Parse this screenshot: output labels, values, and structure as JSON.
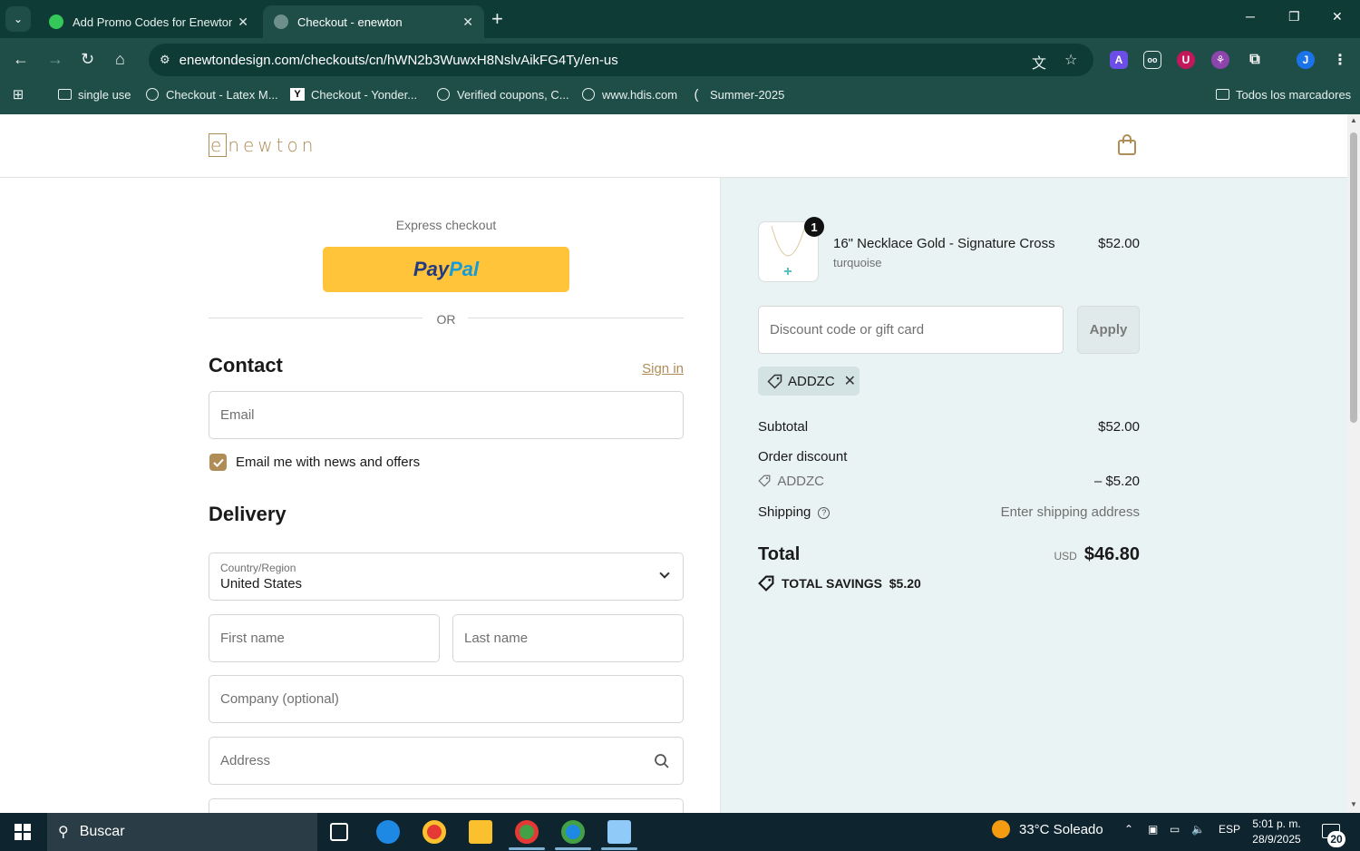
{
  "browser": {
    "tabs": [
      {
        "title": "Add Promo Codes for Enewton",
        "active": false
      },
      {
        "title": "Checkout - enewton",
        "active": true
      }
    ],
    "url": "enewtondesign.com/checkouts/cn/hWN2b3WuwxH8NslvAikFG4Ty/en-us",
    "bookmarks": [
      "single use",
      "Checkout - Latex M...",
      "Checkout - Yonder...",
      "Verified coupons, C...",
      "www.hdis.com",
      "Summer-2025"
    ],
    "all_bookmarks": "Todos los marcadores",
    "profile_initial": "J"
  },
  "store": {
    "logo_text": "enewton",
    "accent_color": "#b08d57"
  },
  "checkout": {
    "express_label": "Express checkout",
    "paypal_label_1": "Pay",
    "paypal_label_2": "Pal",
    "or_label": "OR",
    "contact_heading": "Contact",
    "sign_in": "Sign in",
    "email_placeholder": "Email",
    "news_offers_label": "Email me with news and offers",
    "news_offers_checked": true,
    "delivery_heading": "Delivery",
    "country_label": "Country/Region",
    "country_value": "United States",
    "first_name_placeholder": "First name",
    "last_name_placeholder": "Last name",
    "company_placeholder": "Company (optional)",
    "address_placeholder": "Address"
  },
  "summary": {
    "item": {
      "quantity": "1",
      "name": "16\" Necklace Gold - Signature Cross",
      "variant": "turquoise",
      "price": "$52.00"
    },
    "discount_placeholder": "Discount code or gift card",
    "apply_label": "Apply",
    "applied_code": "ADDZC",
    "subtotal_label": "Subtotal",
    "subtotal_value": "$52.00",
    "order_discount_label": "Order discount",
    "discount_code": "ADDZC",
    "discount_value": "– $5.20",
    "shipping_label": "Shipping",
    "shipping_value": "Enter shipping address",
    "total_label": "Total",
    "currency": "USD",
    "total_value": "$46.80",
    "savings_label": "TOTAL SAVINGS",
    "savings_value": "$5.20"
  },
  "taskbar": {
    "search_label": "Buscar",
    "weather": "33°C Soleado",
    "language": "ESP",
    "time": "5:01 p. m.",
    "date": "28/9/2025",
    "notifications": "20"
  }
}
